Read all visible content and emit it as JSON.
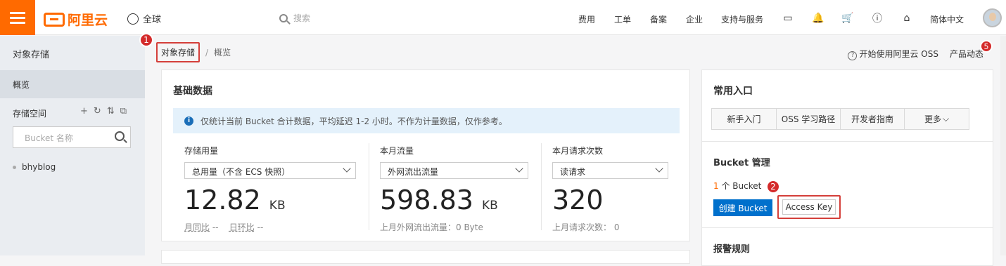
{
  "header": {
    "logo_text": "阿里云",
    "region": "全球",
    "search_placeholder": "搜索",
    "nav": [
      "费用",
      "工单",
      "备案",
      "企业",
      "支持与服务"
    ],
    "language": "简体中文"
  },
  "sidebar": {
    "title": "对象存储",
    "active_item": "概览",
    "section_label": "存储空间",
    "search_placeholder": "Bucket 名称",
    "buckets": [
      "bhyblog"
    ]
  },
  "breadcrumb": {
    "current": "对象存储",
    "separator": "/",
    "page": "概览"
  },
  "badges": {
    "one": "1",
    "two": "2",
    "five": "5"
  },
  "top_links": {
    "start": "开始使用阿里云 OSS",
    "news": "产品动态"
  },
  "basic_data": {
    "title": "基础数据",
    "notice": "仅统计当前 Bucket 合计数据，平均延迟 1-2 小时。不作为计量数据，仅作参考。",
    "metrics": [
      {
        "label": "存储用量",
        "select": "总用量（不含 ECS 快照）",
        "value": "12.82",
        "unit": "KB",
        "foot_a": "月同比",
        "foot_a_val": "--",
        "foot_b": "日环比",
        "foot_b_val": "--"
      },
      {
        "label": "本月流量",
        "select": "外网流出流量",
        "value": "598.83",
        "unit": "KB",
        "foot": "上月外网流出流量：0 Byte"
      },
      {
        "label": "本月请求次数",
        "select": "读请求",
        "value": "320",
        "unit": "",
        "foot": "上月请求次数：  0"
      }
    ]
  },
  "common_entry": {
    "title": "常用入口",
    "buttons": [
      "新手入门",
      "OSS 学习路径",
      "开发者指南",
      "更多"
    ]
  },
  "bucket_mgmt": {
    "title": "Bucket 管理",
    "count": "1",
    "count_suffix": " 个 Bucket",
    "create_label": "创建 Bucket",
    "access_key_label": "Access Key"
  },
  "alarm": {
    "title": "报警规则"
  },
  "colors": {
    "brand": "#ff6a00",
    "primary": "#0070cc",
    "highlight": "#d43f3a"
  }
}
